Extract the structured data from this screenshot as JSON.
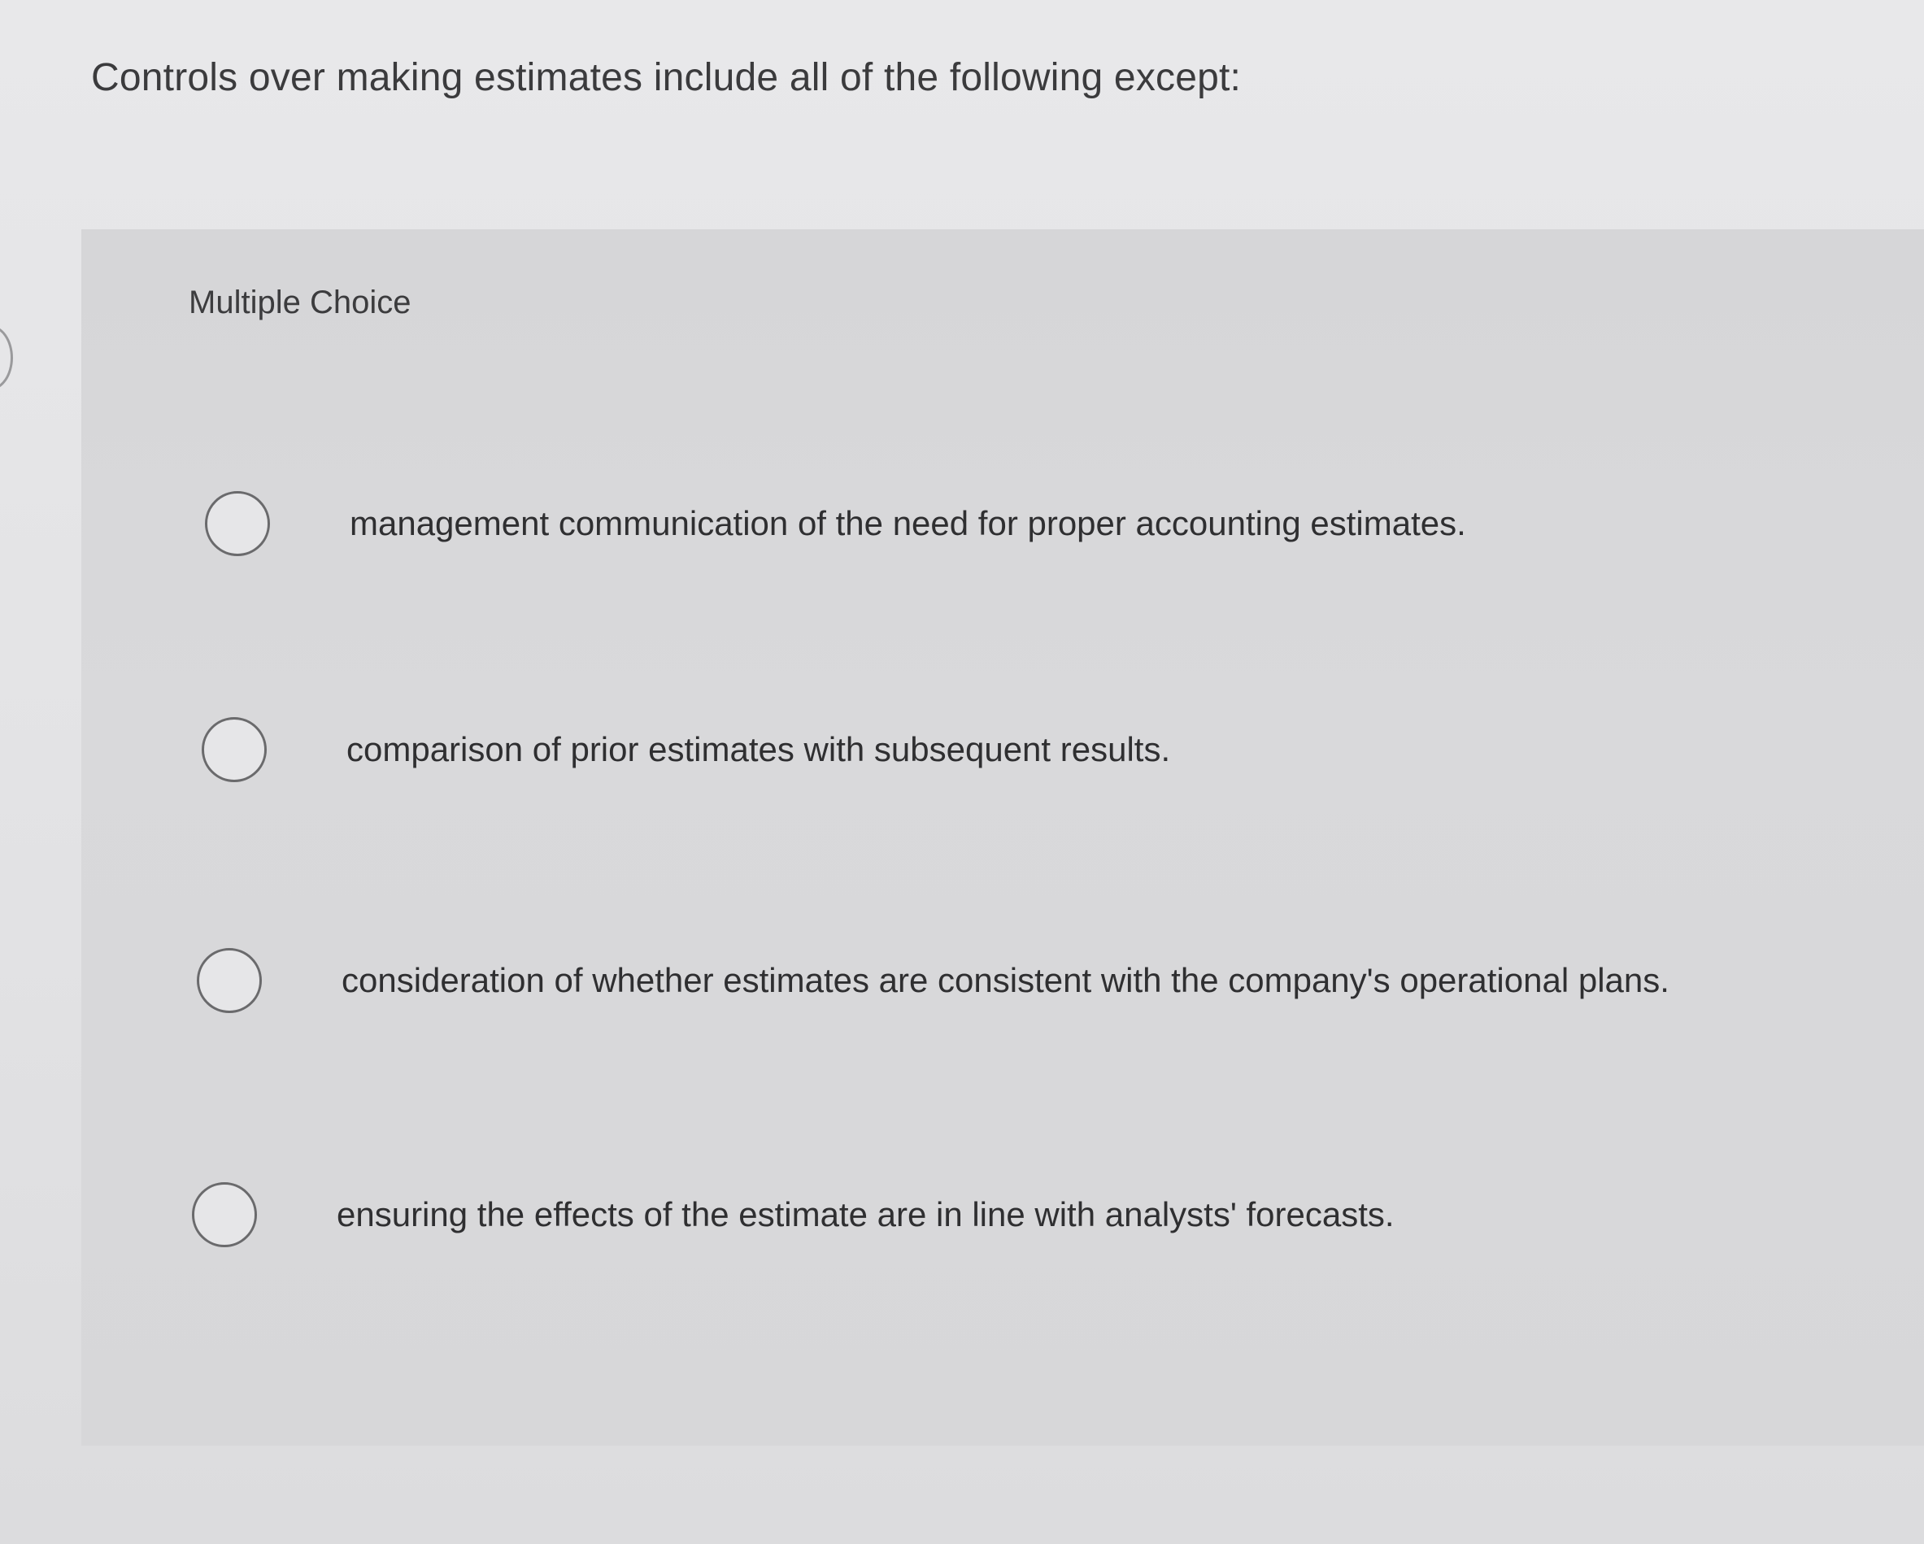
{
  "question": {
    "stem": "Controls over making estimates include all of the following except:"
  },
  "panel": {
    "label": "Multiple Choice"
  },
  "options": [
    {
      "text": "management communication of the need for proper accounting estimates."
    },
    {
      "text": "comparison of prior estimates with subsequent results."
    },
    {
      "text": "consideration of whether estimates are consistent with the company's operational plans."
    },
    {
      "text": "ensuring the effects of the estimate are in line with analysts' forecasts."
    }
  ]
}
